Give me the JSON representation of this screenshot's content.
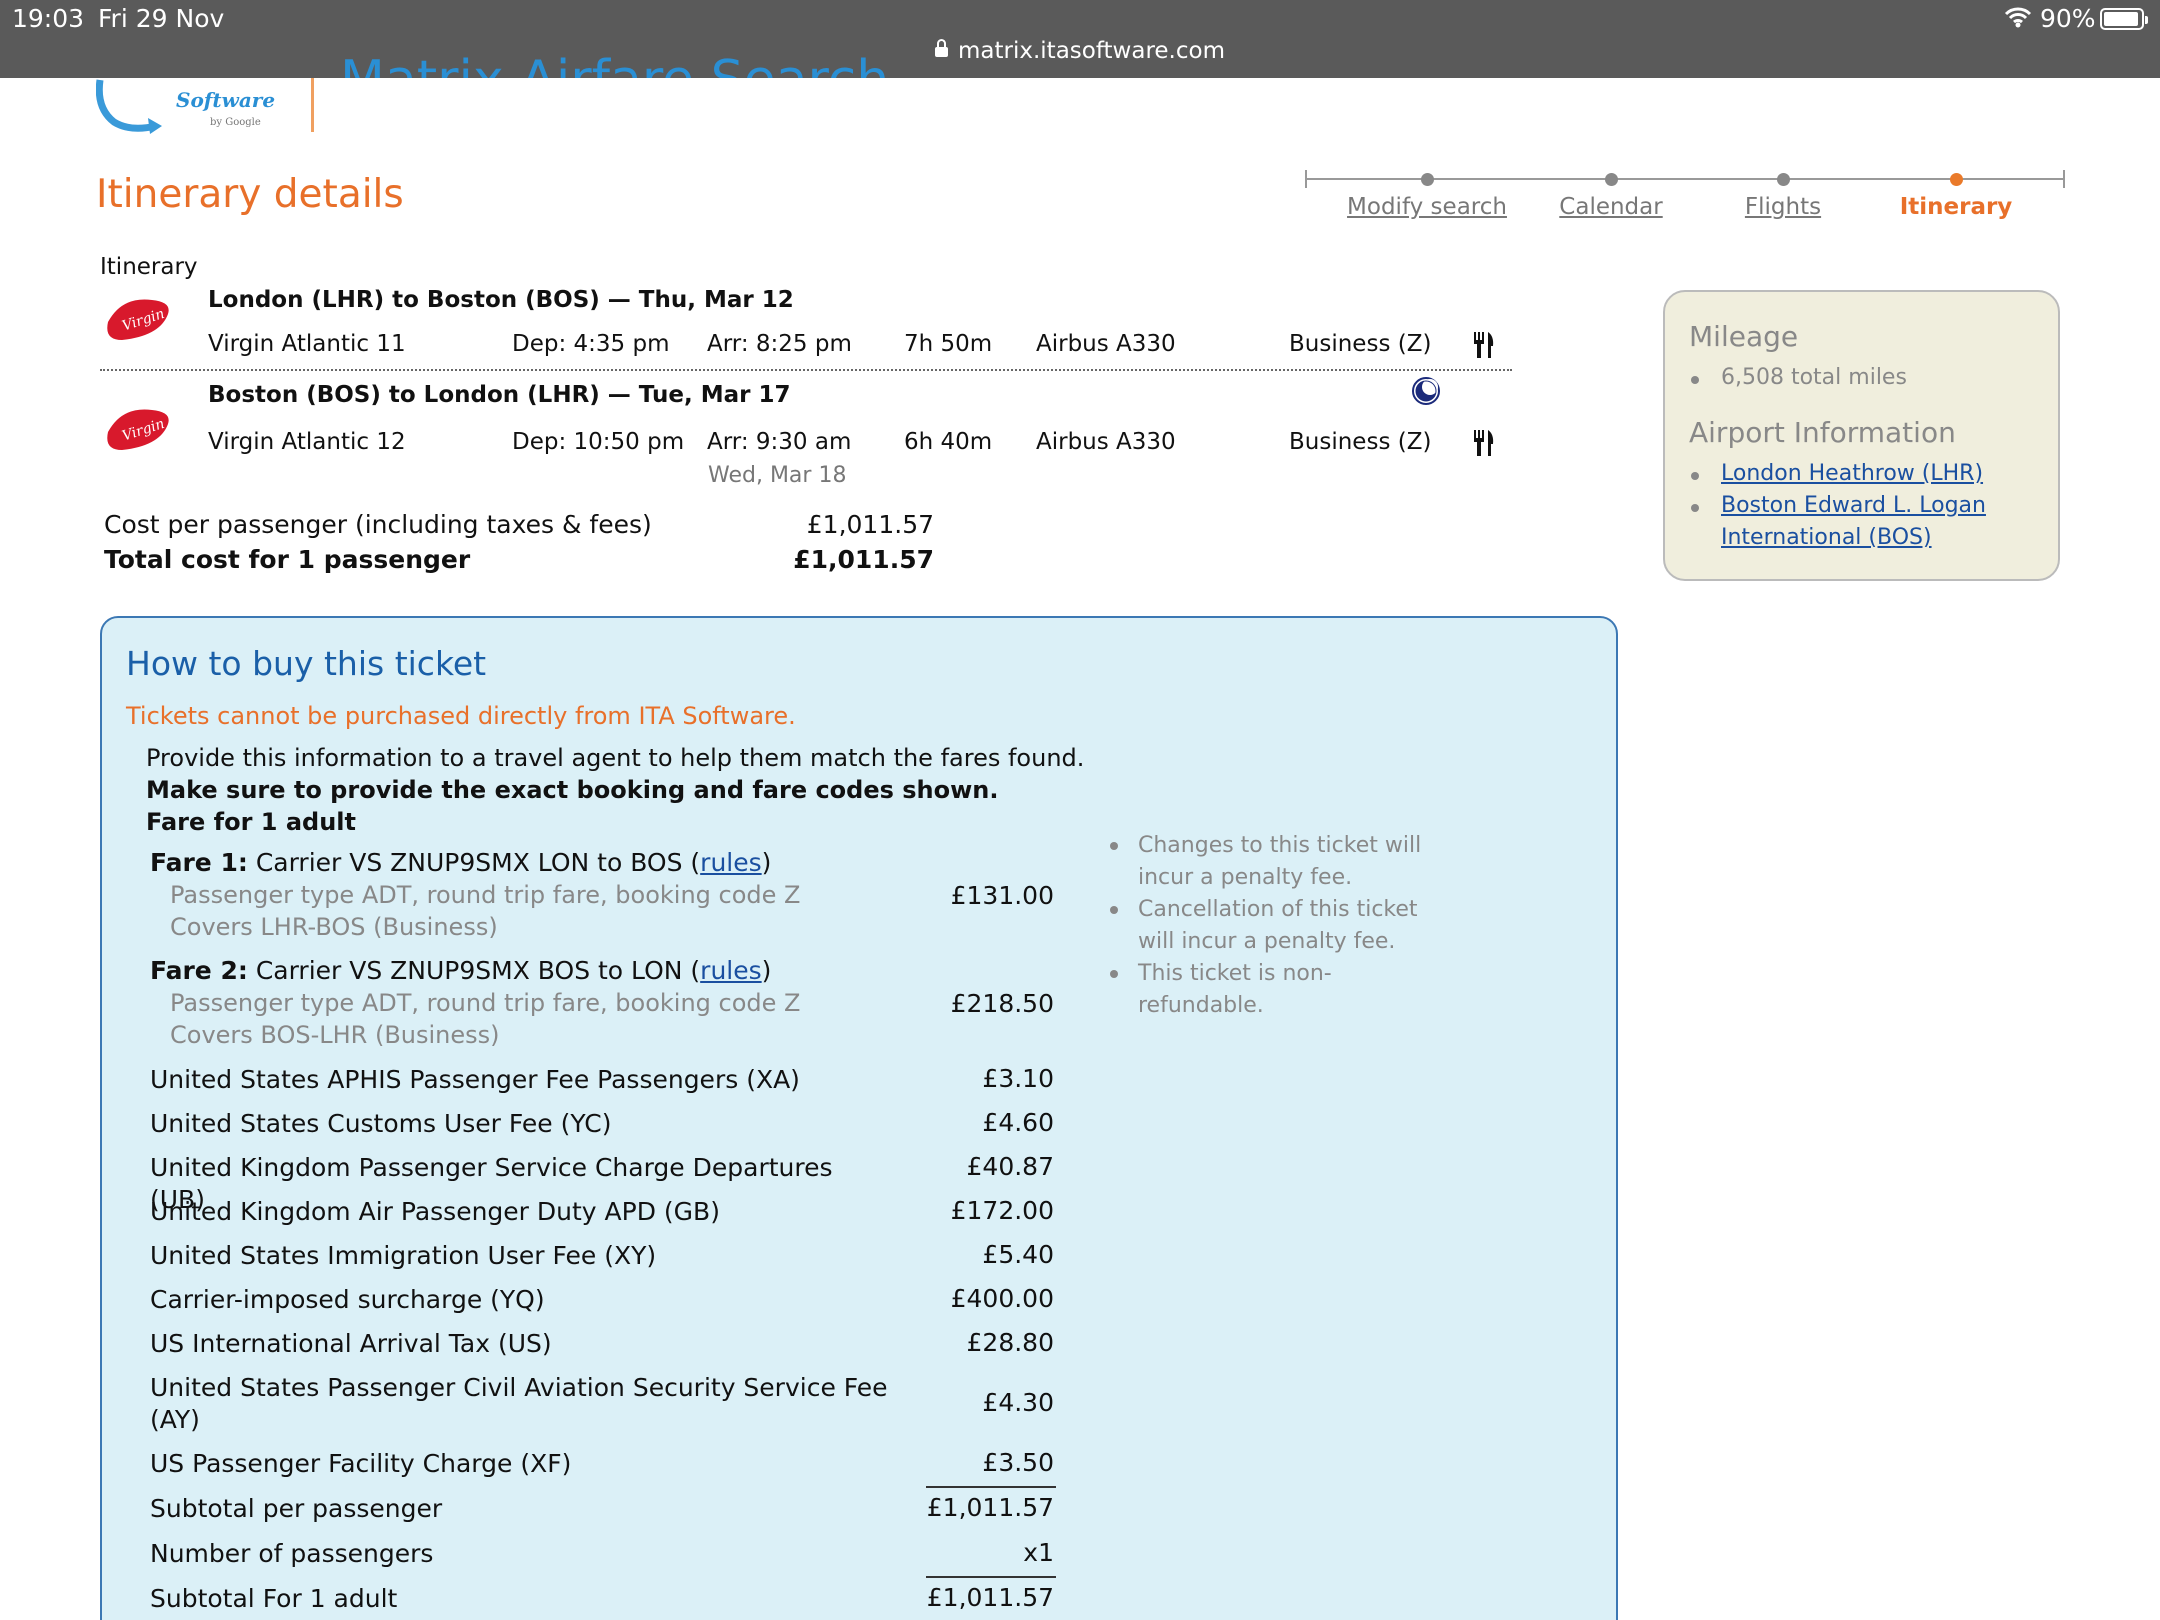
{
  "status_bar": {
    "time": "19:03",
    "date": "Fri 29 Nov",
    "url": "matrix.itasoftware.com",
    "battery": "90%",
    "battery_level": 0.9
  },
  "header": {
    "logo_text": "Software",
    "logo_sub": "by Google",
    "app_title": "Matrix Airfare Search",
    "page_heading": "Itinerary details"
  },
  "steps": [
    {
      "label": "Modify search",
      "active": false
    },
    {
      "label": "Calendar",
      "active": false
    },
    {
      "label": "Flights",
      "active": false
    },
    {
      "label": "Itinerary",
      "active": true
    }
  ],
  "itinerary": {
    "label": "Itinerary",
    "segments": [
      {
        "route": "London (LHR) to Boston (BOS) — Thu, Mar 12",
        "flight": "Virgin Atlantic 11",
        "dep": "Dep: 4:35 pm",
        "arr": "Arr: 8:25 pm",
        "arr_sub": "",
        "duration": "7h 50m",
        "aircraft": "Airbus A330",
        "cabin": "Business (Z)"
      },
      {
        "route": "Boston (BOS) to London (LHR) — Tue, Mar 17",
        "flight": "Virgin Atlantic 12",
        "dep": "Dep: 10:50 pm",
        "arr": "Arr: 9:30 am",
        "arr_sub": "Wed, Mar 18",
        "duration": "6h 40m",
        "aircraft": "Airbus A330",
        "cabin": "Business (Z)"
      }
    ],
    "airline_logo_text": "Virgin"
  },
  "cost": {
    "per_passenger_label": "Cost per passenger (including taxes & fees)",
    "per_passenger_value": "£1,011.57",
    "total_label": "Total cost for 1 passenger",
    "total_value": "£1,011.57"
  },
  "side_panel": {
    "mileage_heading": "Mileage",
    "mileage_value": "6,508 total miles",
    "airport_heading": "Airport Information",
    "airport_1": "London Heathrow (LHR)",
    "airport_2_line1": "Boston Edward L. Logan",
    "airport_2_line2": "International (BOS)"
  },
  "buy": {
    "title": "How to buy this ticket",
    "warning": "Tickets cannot be purchased directly from ITA Software.",
    "line1": "Provide this information to a travel agent to help them match the fares found.",
    "line2": "Make sure to provide the exact booking and fare codes shown.",
    "line3": "Fare for 1 adult",
    "fares": [
      {
        "label": "Fare 1:",
        "text_before": " Carrier VS ZNUP9SMX LON to BOS (",
        "rules": "rules",
        "text_after": ")",
        "sub1": "Passenger type ADT, round trip fare, booking code Z",
        "sub2": "Covers LHR-BOS (Business)",
        "value": "£131.00"
      },
      {
        "label": "Fare 2:",
        "text_before": " Carrier VS ZNUP9SMX BOS to LON (",
        "rules": "rules",
        "text_after": ")",
        "sub1": "Passenger type ADT, round trip fare, booking code Z",
        "sub2": "Covers BOS-LHR (Business)",
        "value": "£218.50"
      }
    ],
    "fees": [
      {
        "label": "United States APHIS Passenger Fee Passengers (XA)",
        "value": "£3.10"
      },
      {
        "label": "United States Customs User Fee (YC)",
        "value": "£4.60"
      },
      {
        "label": "United Kingdom Passenger Service Charge Departures (UB)",
        "value": "£40.87"
      },
      {
        "label": "United Kingdom Air Passenger Duty APD (GB)",
        "value": "£172.00"
      },
      {
        "label": "United States Immigration User Fee (XY)",
        "value": "£5.40"
      },
      {
        "label": "Carrier-imposed surcharge (YQ)",
        "value": "£400.00"
      },
      {
        "label": "US International Arrival Tax (US)",
        "value": "£28.80"
      },
      {
        "label": "United States Passenger Civil Aviation Security Service Fee (AY)",
        "value": "£4.30"
      },
      {
        "label": "US Passenger Facility Charge (XF)",
        "value": "£3.50"
      }
    ],
    "subtotal_label": "Subtotal per passenger",
    "subtotal_value": "£1,011.57",
    "passengers_label": "Number of passengers",
    "passengers_value": "x1",
    "adult_subtotal_label": "Subtotal For 1 adult",
    "adult_subtotal_value": "£1,011.57",
    "notes": [
      "Changes to this ticket will incur a penalty fee.",
      "Cancellation of this ticket will incur a penalty fee.",
      "This ticket is non-refundable."
    ]
  },
  "colors": {
    "accent_orange": "#e8702a",
    "link_blue": "#1a4fa0",
    "buy_box_bg": "#dbf0f7",
    "side_panel_bg": "#f0eedd",
    "virgin_red": "#d8192c"
  }
}
